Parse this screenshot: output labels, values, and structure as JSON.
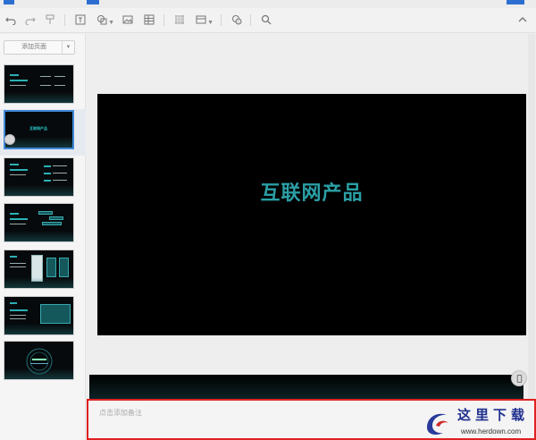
{
  "toolbar": {
    "icons": [
      "undo-icon",
      "redo-icon",
      "format-painter-icon",
      "textbox-icon",
      "shape-icon",
      "image-icon",
      "table-icon",
      "texture-icon",
      "media-icon",
      "comment-icon",
      "search-icon",
      "collapse-icon"
    ]
  },
  "sidebar": {
    "add_page_label": "添加页面",
    "thumbnails": [
      {
        "index": 1,
        "selected": false
      },
      {
        "index": 2,
        "selected": true,
        "title": "互联网产品"
      },
      {
        "index": 3,
        "selected": false
      },
      {
        "index": 4,
        "selected": false
      },
      {
        "index": 5,
        "selected": false
      },
      {
        "index": 6,
        "selected": false
      },
      {
        "index": 7,
        "selected": false
      }
    ]
  },
  "slide": {
    "title": "互联网产品"
  },
  "notes": {
    "placeholder": "点击添加备注"
  },
  "watermark": {
    "name": "这里下载",
    "url": "www.herdown.com"
  },
  "colors": {
    "accent": "#2b9fa5",
    "selection": "#3f88d8",
    "notes_border": "#e02020",
    "brand_blue": "#2c6fd1"
  }
}
